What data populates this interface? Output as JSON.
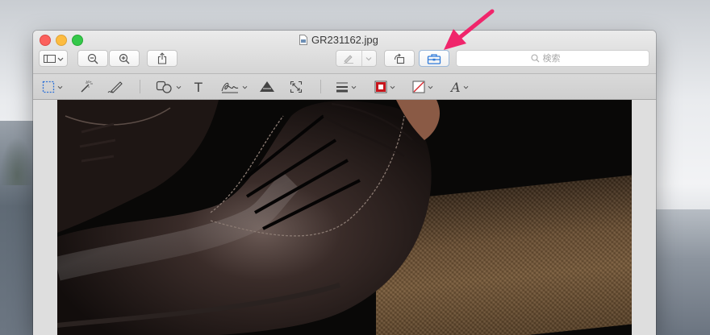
{
  "window": {
    "title": "GR231162.jpg"
  },
  "toolbar": {
    "sidebar_button": "sidebar-toggle",
    "zoom_out": "zoom-out",
    "zoom_in": "zoom-in",
    "share": "share",
    "markup_pen": "pen",
    "rotate": "rotate",
    "toolbox": "toolbox",
    "search_placeholder": "検索"
  },
  "markup_toolbar": {
    "tools": [
      "selection",
      "instant-alpha",
      "sketch",
      "shapes",
      "text",
      "sign",
      "adjust-color",
      "adjust-size",
      "shape-style",
      "border-color",
      "fill-color",
      "text-style"
    ],
    "text_tool_label": "T",
    "font_tool_label": "A",
    "border_color": "#c8161d",
    "fill_color": "none"
  },
  "annotation": {
    "arrow_color": "#f0256b"
  },
  "image": {
    "subject": "leather-oxford-shoes"
  }
}
